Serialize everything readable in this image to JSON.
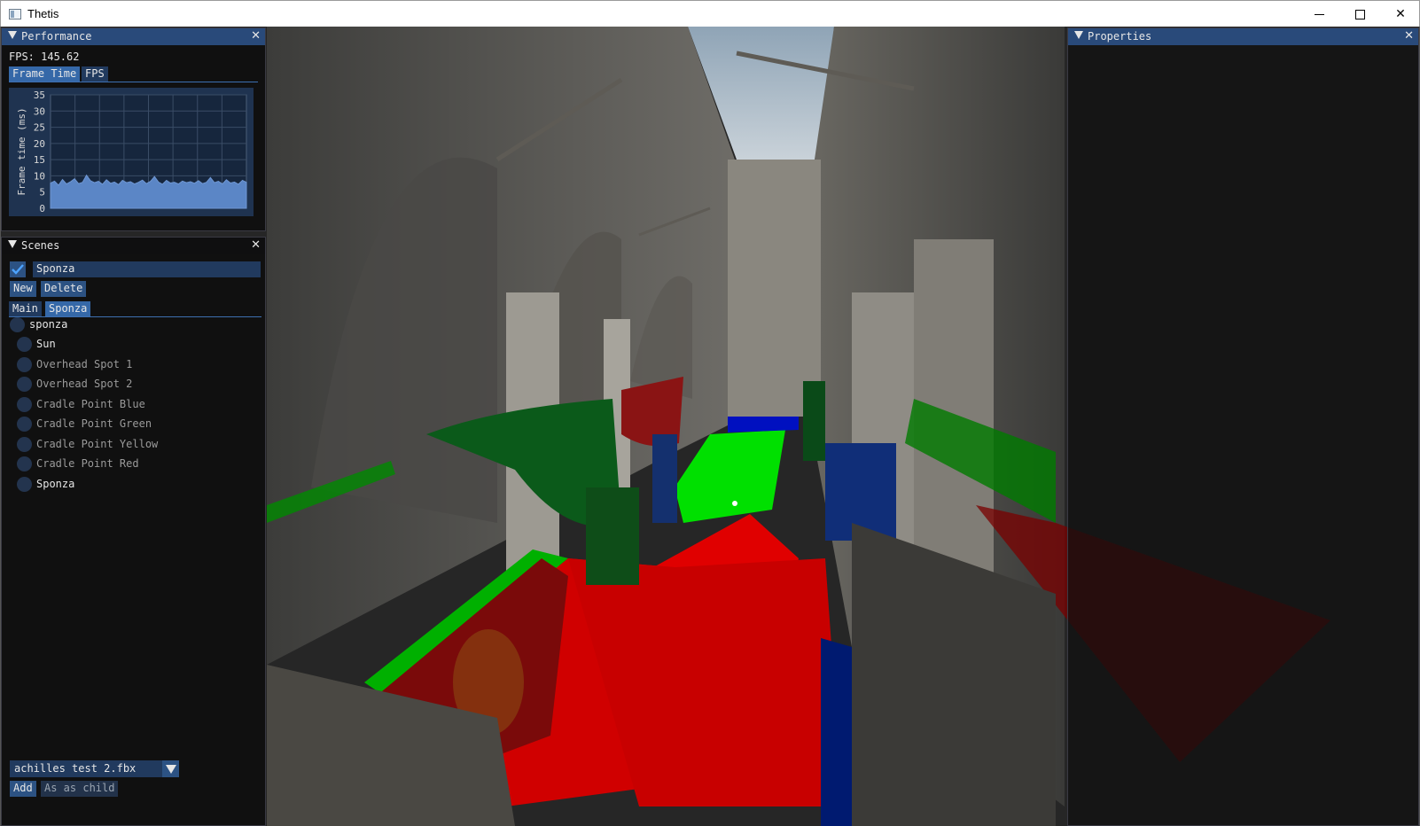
{
  "window": {
    "title": "Thetis"
  },
  "performance": {
    "title": "Performance",
    "fps_text": "FPS: 145.62",
    "tabs": [
      "Frame Time",
      "FPS"
    ],
    "active_tab": 0,
    "plot": {
      "ylabel": "Frame time (ms)",
      "yticks": [
        "35",
        "30",
        "25",
        "20",
        "15",
        "10",
        "5",
        "0"
      ],
      "ylim": [
        0,
        35
      ]
    }
  },
  "chart_data": {
    "type": "area",
    "title": "",
    "xlabel": "",
    "ylabel": "Frame time (ms)",
    "ylim": [
      0,
      35
    ],
    "grid": true,
    "series": [
      {
        "values": [
          7.8,
          8.4,
          7.1,
          8.9,
          7.5,
          8.2,
          9.1,
          7.6,
          8.0,
          10.2,
          8.5,
          7.9,
          8.3,
          7.4,
          8.8,
          7.7,
          8.1,
          7.3,
          8.6,
          7.9,
          8.2,
          7.5,
          8.0,
          8.7,
          7.6,
          8.3,
          9.8,
          8.1,
          7.4,
          8.6,
          7.8,
          8.0,
          7.5,
          8.4,
          7.9,
          8.2,
          7.7,
          8.5,
          7.6,
          8.0,
          9.5,
          7.9,
          8.3,
          7.5,
          8.8,
          7.8,
          8.1,
          7.4,
          8.6,
          8.0
        ]
      }
    ]
  },
  "scenes": {
    "title": "Scenes",
    "current_scene_name": "Sponza",
    "new_label": "New",
    "delete_label": "Delete",
    "tabs": [
      "Main",
      "Sponza"
    ],
    "active_tab": 1,
    "items": [
      {
        "label": "sponza",
        "dim": false
      },
      {
        "label": "Sun",
        "dim": false
      },
      {
        "label": "Overhead Spot 1",
        "dim": true
      },
      {
        "label": "Overhead Spot 2",
        "dim": true
      },
      {
        "label": "Cradle Point Blue",
        "dim": true
      },
      {
        "label": "Cradle Point Green",
        "dim": true
      },
      {
        "label": "Cradle Point Yellow",
        "dim": true
      },
      {
        "label": "Cradle Point Red",
        "dim": true
      },
      {
        "label": "Sponza",
        "dim": false
      }
    ],
    "file_combo_value": "achilles test 2.fbx",
    "add_label": "Add",
    "as_child_label": "As as child"
  },
  "properties": {
    "title": "Properties"
  }
}
